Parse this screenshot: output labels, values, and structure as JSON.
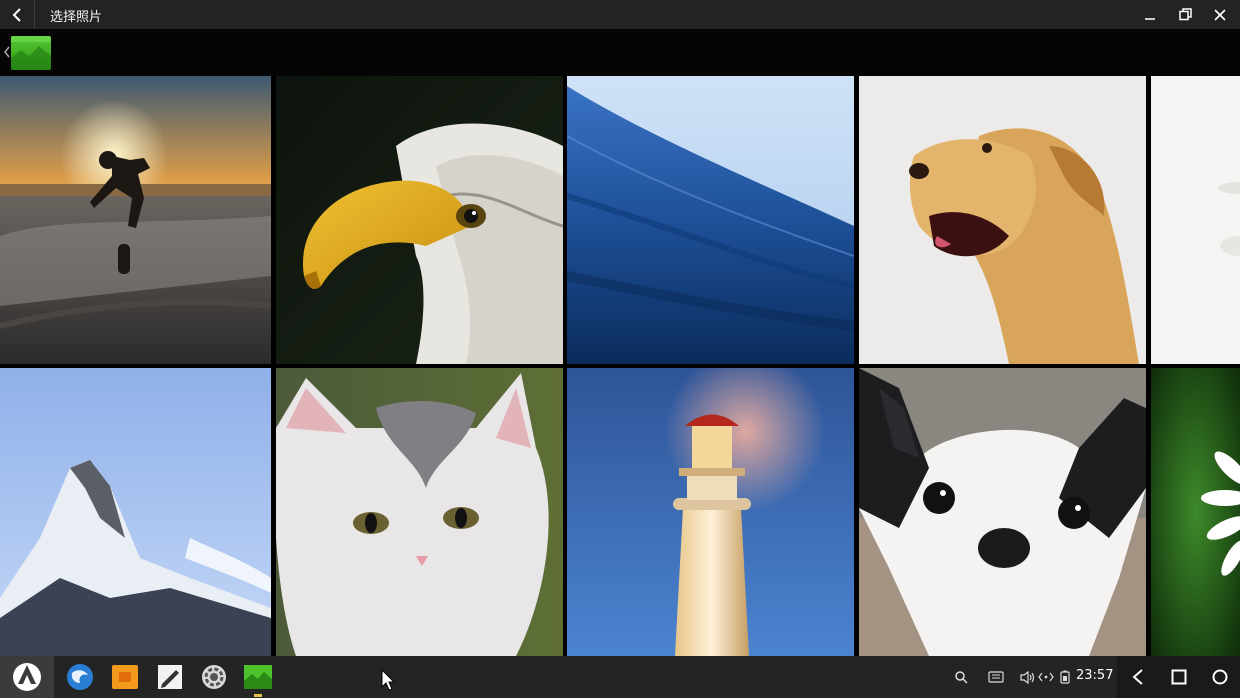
{
  "window": {
    "title": "选择照片",
    "back_icon": "back-arrow-icon",
    "minimize_icon": "minimize-icon",
    "restore_icon": "restore-icon",
    "close_icon": "close-icon"
  },
  "toolbar": {
    "breadcrumb_icon": "chevron-left-icon",
    "folder_icon": "image-folder-icon"
  },
  "photos": [
    {
      "subject": "skateboarder-sunset"
    },
    {
      "subject": "bald-eagle"
    },
    {
      "subject": "ocean-wave"
    },
    {
      "subject": "golden-retriever"
    },
    {
      "subject": "white-flower"
    },
    {
      "subject": "matterhorn-mountain"
    },
    {
      "subject": "kitten"
    },
    {
      "subject": "lighthouse"
    },
    {
      "subject": "french-bulldog-puppy"
    },
    {
      "subject": "daisy-green"
    }
  ],
  "taskbar": {
    "launcher_icon": "launcher-icon",
    "apps": [
      "browser-icon",
      "files-icon",
      "text-editor-icon",
      "settings-icon",
      "gallery-icon"
    ]
  },
  "tray": {
    "icons": [
      "search-icon",
      "keyboard-icon",
      "volume-icon",
      "network-icon",
      "battery-icon"
    ],
    "clock": "23:57"
  },
  "nav": {
    "icons": [
      "nav-back-icon",
      "nav-recents-icon",
      "nav-home-icon"
    ]
  },
  "colors": {
    "titlebar": "#232323",
    "taskbar": "#242424",
    "accent_green": "#3cb521"
  }
}
